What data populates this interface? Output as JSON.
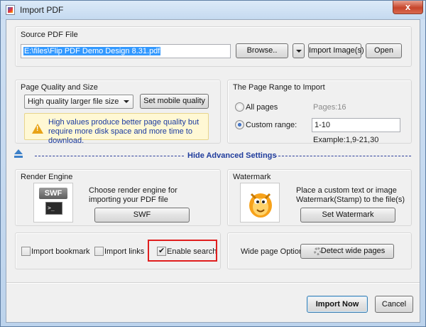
{
  "window": {
    "title": "Import PDF",
    "close_label": "x"
  },
  "source": {
    "label": "Source PDF File",
    "file_path": "E:\\files\\Flip PDF Demo Design 8.31.pdf",
    "browse_label": "Browse..",
    "import_images_label": "Import Image(s)",
    "open_label": "Open"
  },
  "quality": {
    "label": "Page Quality and Size",
    "selected": "High quality larger file size",
    "mobile_label": "Set mobile quality",
    "note": "High values produce better page quality but require more disk space and more time to download."
  },
  "range": {
    "label": "The Page Range to Import",
    "all_pages_label": "All pages",
    "pages_info": "Pages:16",
    "custom_label": "Custom range:",
    "custom_value": "1-10",
    "example": "Example:1,9-21,30",
    "selected": "custom"
  },
  "advanced": {
    "label": "Hide Advanced Settings"
  },
  "render": {
    "label": "Render Engine",
    "description": "Choose render engine for importing your PDF file",
    "button_label": "SWF",
    "tile_text": "SWF"
  },
  "watermark": {
    "label": "Watermark",
    "description": "Place a custom text or image Watermark(Stamp) to the file(s)",
    "button_label": "Set Watermark"
  },
  "options": {
    "import_bookmark": {
      "label": "Import bookmark",
      "checked": false
    },
    "import_links": {
      "label": "Import links",
      "checked": false
    },
    "enable_search": {
      "label": "Enable search",
      "checked": true
    }
  },
  "wide_page": {
    "label": "Wide page Option",
    "button_label": "Detect wide pages"
  },
  "footer": {
    "import_now_label": "Import Now",
    "cancel_label": "Cancel"
  },
  "colors": {
    "highlight": "#e01e1e",
    "link_text": "#1f3c9c",
    "selection": "#3399ff"
  }
}
